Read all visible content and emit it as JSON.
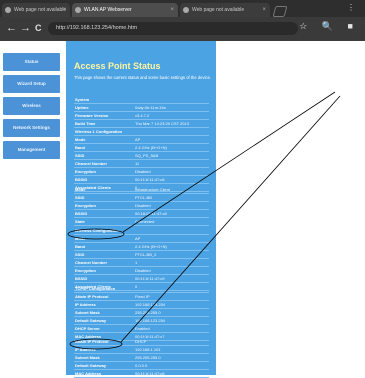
{
  "tabs": [
    {
      "label": "Web page not available"
    },
    {
      "label": "WLAN AP Webserver"
    },
    {
      "label": "Web page not available"
    }
  ],
  "url": "http://192.168.123.254/home.htm",
  "menu_glyph": "⋮",
  "nav": {
    "back": "←",
    "forward": "→",
    "reload": "C"
  },
  "toolbar_icons": "☆ 🔍 ■",
  "sidebar": [
    {
      "label": "Status"
    },
    {
      "label": "Wizard Setup"
    },
    {
      "label": "Wireless"
    },
    {
      "label": "Network Settings"
    },
    {
      "label": "Management"
    }
  ],
  "title": "Access Point Status",
  "description": "This page shows the current status and some basic settings of the device.",
  "system": [
    {
      "k": "System",
      "v": ""
    },
    {
      "k": "Uptime",
      "v": "0day:0h:41m:34s"
    },
    {
      "k": "Firmware Version",
      "v": "v3.4.7.2"
    },
    {
      "k": "Build Time",
      "v": "Thu Mar 7 14:23:29 CST 2013"
    }
  ],
  "wireless1": [
    {
      "k": "Wireless 1 Configuration",
      "v": ""
    },
    {
      "k": "Mode",
      "v": "AP"
    },
    {
      "k": "Band",
      "v": "2.4 GHz (B+G+N)"
    },
    {
      "k": "SSID",
      "v": "SQ_PS_5AB"
    },
    {
      "k": "Channel Number",
      "v": "11"
    },
    {
      "k": "Encryption",
      "v": "Disabled"
    },
    {
      "k": "BSSID",
      "v": "00:1f:1f:11:47:c8"
    },
    {
      "k": "Associated Clients",
      "v": "0"
    }
  ],
  "vap": [
    {
      "k": "Mode",
      "v": "Infrastructure Client"
    },
    {
      "k": "SSID",
      "v": "PTCL-BB"
    },
    {
      "k": "Encryption",
      "v": "Disabled"
    },
    {
      "k": "BSSID",
      "v": "00:18:02:11:47:c8"
    },
    {
      "k": "State",
      "v": "Connected"
    }
  ],
  "wireless2": [
    {
      "k": "Wireless Configuration",
      "v": ""
    },
    {
      "k": "Mode",
      "v": "AP"
    },
    {
      "k": "Band",
      "v": "2.4 GHz (B+G+N)"
    },
    {
      "k": "SSID",
      "v": "PTCL-BB_2"
    },
    {
      "k": "Channel Number",
      "v": "1"
    },
    {
      "k": "Encryption",
      "v": "Disabled"
    },
    {
      "k": "BSSID",
      "v": "00:1f:1f:11:47:c9"
    },
    {
      "k": "Associated Clients",
      "v": "0"
    }
  ],
  "tcpip": [
    {
      "k": "TCP/IP Configuration",
      "v": ""
    },
    {
      "k": "Attain IP Protocol",
      "v": "Fixed IP"
    },
    {
      "k": "IP Address",
      "v": "192.168.123.254"
    },
    {
      "k": "Subnet Mask",
      "v": "255.255.255.0"
    },
    {
      "k": "Default Gateway",
      "v": "192.168.123.254"
    },
    {
      "k": "DHCP Server",
      "v": "Enabled"
    },
    {
      "k": "MAC Address",
      "v": "00:1f:1f:11:47:c7"
    }
  ],
  "wan": [
    {
      "k": "Attain IP Protocol",
      "v": "DHCP"
    },
    {
      "k": "IP Address",
      "v": "192.168.1.101"
    },
    {
      "k": "Subnet Mask",
      "v": "255.255.255.0"
    },
    {
      "k": "Default Gateway",
      "v": "0.0.0.0"
    },
    {
      "k": "MAC Address",
      "v": "00:1f:1f:11:47:c8"
    }
  ]
}
